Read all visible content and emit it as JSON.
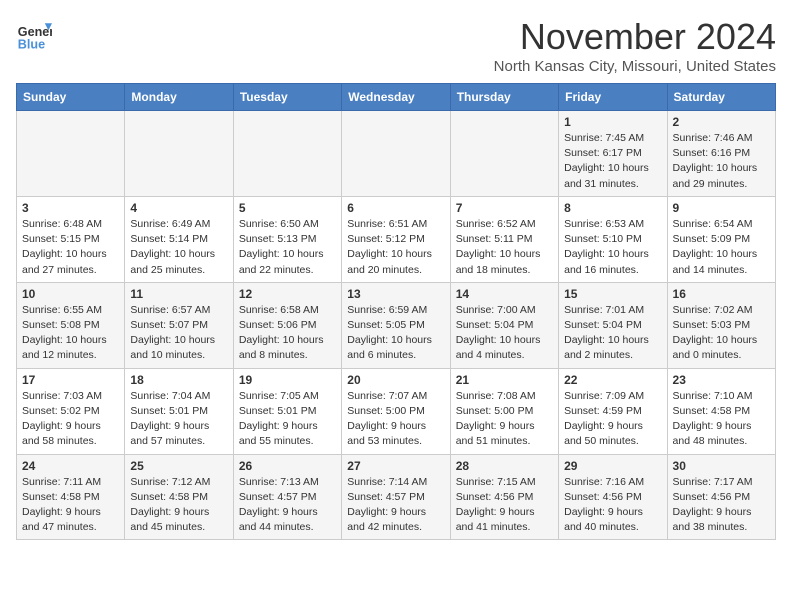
{
  "header": {
    "logo": {
      "line1": "General",
      "line2": "Blue"
    },
    "title": "November 2024",
    "location": "North Kansas City, Missouri, United States"
  },
  "days_of_week": [
    "Sunday",
    "Monday",
    "Tuesday",
    "Wednesday",
    "Thursday",
    "Friday",
    "Saturday"
  ],
  "weeks": [
    [
      {
        "day": "",
        "info": ""
      },
      {
        "day": "",
        "info": ""
      },
      {
        "day": "",
        "info": ""
      },
      {
        "day": "",
        "info": ""
      },
      {
        "day": "",
        "info": ""
      },
      {
        "day": "1",
        "info": "Sunrise: 7:45 AM\nSunset: 6:17 PM\nDaylight: 10 hours\nand 31 minutes."
      },
      {
        "day": "2",
        "info": "Sunrise: 7:46 AM\nSunset: 6:16 PM\nDaylight: 10 hours\nand 29 minutes."
      }
    ],
    [
      {
        "day": "3",
        "info": "Sunrise: 6:48 AM\nSunset: 5:15 PM\nDaylight: 10 hours\nand 27 minutes."
      },
      {
        "day": "4",
        "info": "Sunrise: 6:49 AM\nSunset: 5:14 PM\nDaylight: 10 hours\nand 25 minutes."
      },
      {
        "day": "5",
        "info": "Sunrise: 6:50 AM\nSunset: 5:13 PM\nDaylight: 10 hours\nand 22 minutes."
      },
      {
        "day": "6",
        "info": "Sunrise: 6:51 AM\nSunset: 5:12 PM\nDaylight: 10 hours\nand 20 minutes."
      },
      {
        "day": "7",
        "info": "Sunrise: 6:52 AM\nSunset: 5:11 PM\nDaylight: 10 hours\nand 18 minutes."
      },
      {
        "day": "8",
        "info": "Sunrise: 6:53 AM\nSunset: 5:10 PM\nDaylight: 10 hours\nand 16 minutes."
      },
      {
        "day": "9",
        "info": "Sunrise: 6:54 AM\nSunset: 5:09 PM\nDaylight: 10 hours\nand 14 minutes."
      }
    ],
    [
      {
        "day": "10",
        "info": "Sunrise: 6:55 AM\nSunset: 5:08 PM\nDaylight: 10 hours\nand 12 minutes."
      },
      {
        "day": "11",
        "info": "Sunrise: 6:57 AM\nSunset: 5:07 PM\nDaylight: 10 hours\nand 10 minutes."
      },
      {
        "day": "12",
        "info": "Sunrise: 6:58 AM\nSunset: 5:06 PM\nDaylight: 10 hours\nand 8 minutes."
      },
      {
        "day": "13",
        "info": "Sunrise: 6:59 AM\nSunset: 5:05 PM\nDaylight: 10 hours\nand 6 minutes."
      },
      {
        "day": "14",
        "info": "Sunrise: 7:00 AM\nSunset: 5:04 PM\nDaylight: 10 hours\nand 4 minutes."
      },
      {
        "day": "15",
        "info": "Sunrise: 7:01 AM\nSunset: 5:04 PM\nDaylight: 10 hours\nand 2 minutes."
      },
      {
        "day": "16",
        "info": "Sunrise: 7:02 AM\nSunset: 5:03 PM\nDaylight: 10 hours\nand 0 minutes."
      }
    ],
    [
      {
        "day": "17",
        "info": "Sunrise: 7:03 AM\nSunset: 5:02 PM\nDaylight: 9 hours\nand 58 minutes."
      },
      {
        "day": "18",
        "info": "Sunrise: 7:04 AM\nSunset: 5:01 PM\nDaylight: 9 hours\nand 57 minutes."
      },
      {
        "day": "19",
        "info": "Sunrise: 7:05 AM\nSunset: 5:01 PM\nDaylight: 9 hours\nand 55 minutes."
      },
      {
        "day": "20",
        "info": "Sunrise: 7:07 AM\nSunset: 5:00 PM\nDaylight: 9 hours\nand 53 minutes."
      },
      {
        "day": "21",
        "info": "Sunrise: 7:08 AM\nSunset: 5:00 PM\nDaylight: 9 hours\nand 51 minutes."
      },
      {
        "day": "22",
        "info": "Sunrise: 7:09 AM\nSunset: 4:59 PM\nDaylight: 9 hours\nand 50 minutes."
      },
      {
        "day": "23",
        "info": "Sunrise: 7:10 AM\nSunset: 4:58 PM\nDaylight: 9 hours\nand 48 minutes."
      }
    ],
    [
      {
        "day": "24",
        "info": "Sunrise: 7:11 AM\nSunset: 4:58 PM\nDaylight: 9 hours\nand 47 minutes."
      },
      {
        "day": "25",
        "info": "Sunrise: 7:12 AM\nSunset: 4:58 PM\nDaylight: 9 hours\nand 45 minutes."
      },
      {
        "day": "26",
        "info": "Sunrise: 7:13 AM\nSunset: 4:57 PM\nDaylight: 9 hours\nand 44 minutes."
      },
      {
        "day": "27",
        "info": "Sunrise: 7:14 AM\nSunset: 4:57 PM\nDaylight: 9 hours\nand 42 minutes."
      },
      {
        "day": "28",
        "info": "Sunrise: 7:15 AM\nSunset: 4:56 PM\nDaylight: 9 hours\nand 41 minutes."
      },
      {
        "day": "29",
        "info": "Sunrise: 7:16 AM\nSunset: 4:56 PM\nDaylight: 9 hours\nand 40 minutes."
      },
      {
        "day": "30",
        "info": "Sunrise: 7:17 AM\nSunset: 4:56 PM\nDaylight: 9 hours\nand 38 minutes."
      }
    ]
  ]
}
